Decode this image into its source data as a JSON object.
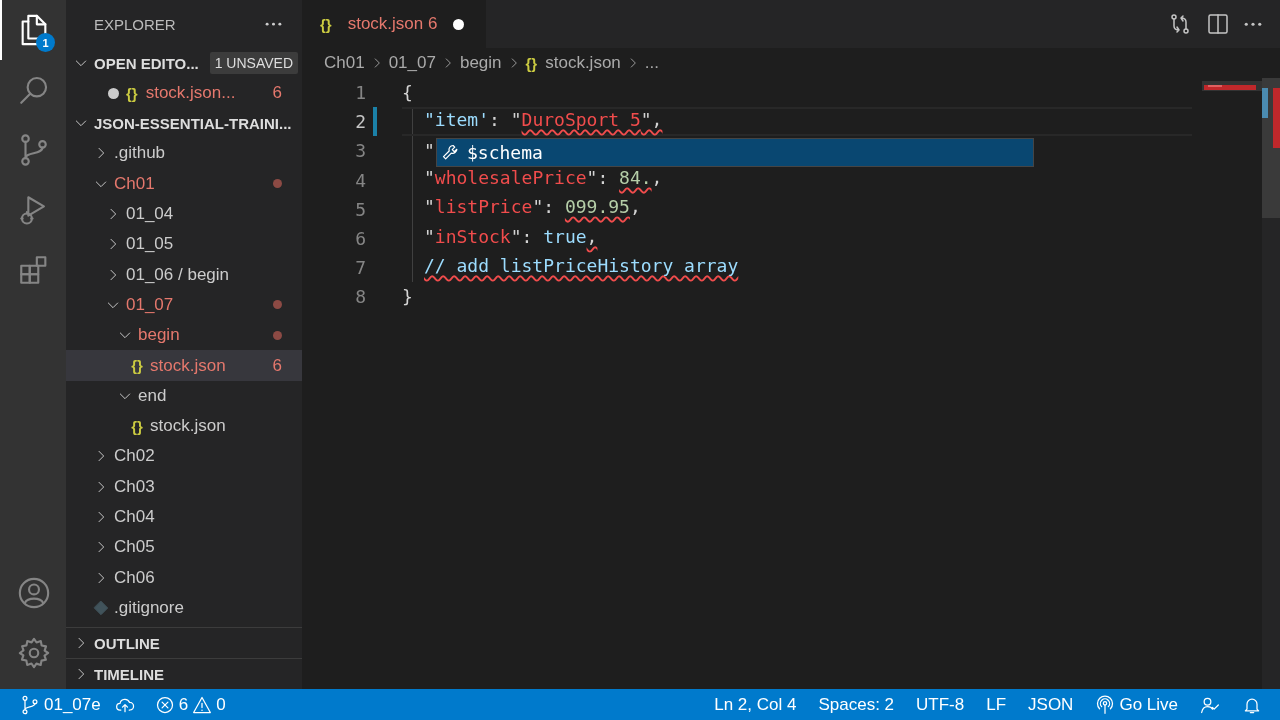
{
  "activity_bar": {
    "items": [
      {
        "kind": "files",
        "selected": true,
        "badge": "1"
      },
      {
        "kind": "search",
        "selected": false
      },
      {
        "kind": "scm",
        "selected": false
      },
      {
        "kind": "debug",
        "selected": false
      },
      {
        "kind": "extensions",
        "selected": false
      }
    ],
    "bottom": [
      {
        "kind": "account"
      },
      {
        "kind": "settings"
      }
    ]
  },
  "explorer": {
    "title": "EXPLORER",
    "open_editors": {
      "title": "OPEN EDITO...",
      "expanded": true,
      "badge": "1 UNSAVED",
      "items": [
        {
          "dirty": true,
          "icon": "{}",
          "label": "stock.json...",
          "problems": "6",
          "selected": false
        }
      ]
    },
    "project": {
      "title": "JSON-ESSENTIAL-TRAINI...",
      "expanded": true,
      "items": [
        {
          "kind": "folder",
          "label": ".github",
          "expanded": false,
          "modified": false,
          "selected": false
        },
        {
          "kind": "folder",
          "label": "Ch01",
          "expanded": true,
          "modified": true,
          "selected": false,
          "children": [
            {
              "kind": "folder",
              "label": "01_04",
              "expanded": false,
              "modified": false,
              "selected": false
            },
            {
              "kind": "folder",
              "label": "01_05",
              "expanded": false,
              "modified": false,
              "selected": false
            },
            {
              "kind": "folder",
              "label": "01_06 / begin",
              "expanded": false,
              "modified": false,
              "selected": false
            },
            {
              "kind": "folder",
              "label": "01_07",
              "expanded": true,
              "modified": true,
              "selected": false,
              "children": [
                {
                  "kind": "folder",
                  "label": "begin",
                  "expanded": true,
                  "modified": true,
                  "selected": false,
                  "children": [
                    {
                      "kind": "json-file",
                      "icon": "{}",
                      "label": "stock.json",
                      "modified": true,
                      "problems": "6",
                      "selected": true
                    }
                  ]
                },
                {
                  "kind": "folder",
                  "label": "end",
                  "expanded": true,
                  "modified": false,
                  "selected": false,
                  "children": [
                    {
                      "kind": "json-file",
                      "icon": "{}",
                      "label": "stock.json",
                      "modified": false,
                      "selected": false
                    }
                  ]
                }
              ]
            }
          ]
        },
        {
          "kind": "folder",
          "label": "Ch02",
          "expanded": false,
          "modified": false,
          "selected": false
        },
        {
          "kind": "folder",
          "label": "Ch03",
          "expanded": false,
          "modified": false,
          "selected": false
        },
        {
          "kind": "folder",
          "label": "Ch04",
          "expanded": false,
          "modified": false,
          "selected": false
        },
        {
          "kind": "folder",
          "label": "Ch05",
          "expanded": false,
          "modified": false,
          "selected": false
        },
        {
          "kind": "folder",
          "label": "Ch06",
          "expanded": false,
          "modified": false,
          "selected": false
        },
        {
          "kind": "git-file",
          "label": ".gitignore",
          "modified": false,
          "selected": false
        }
      ]
    },
    "sections": [
      {
        "title": "OUTLINE",
        "expanded": false
      },
      {
        "title": "TIMELINE",
        "expanded": false
      }
    ]
  },
  "tabs": [
    {
      "icon": "{}",
      "label": "stock.json",
      "problems": "6",
      "dirty": true,
      "selected": true
    }
  ],
  "editor_actions": [
    {
      "kind": "compare"
    },
    {
      "kind": "split"
    },
    {
      "kind": "more"
    }
  ],
  "breadcrumb": [
    {
      "label": "Ch01"
    },
    {
      "label": "01_07"
    },
    {
      "label": "begin"
    },
    {
      "icon": "{}",
      "label": "stock.json"
    },
    {
      "label": "..."
    }
  ],
  "code": {
    "lines": [
      {
        "number": "1",
        "current": false,
        "tokens": [
          {
            "text": "{",
            "kind": "punct"
          }
        ]
      },
      {
        "number": "2",
        "current": true,
        "tokens": [
          {
            "text": "\"item'",
            "kind": "key"
          },
          {
            "text": ": ",
            "kind": "punct"
          },
          {
            "text": "\"",
            "kind": "punct"
          },
          {
            "text": "DuroSport 5",
            "kind": "string",
            "squiggle": true
          },
          {
            "text": "\",",
            "kind": "punct",
            "squiggle": true
          }
        ]
      },
      {
        "number": "3",
        "current": false,
        "tokens": [
          {
            "text": "\"",
            "kind": "punct"
          }
        ]
      },
      {
        "number": "4",
        "current": false,
        "tokens": [
          {
            "text": "\"",
            "kind": "punct"
          },
          {
            "text": "wholesalePrice",
            "kind": "invalid-key"
          },
          {
            "text": "\": ",
            "kind": "punct"
          },
          {
            "text": "84.",
            "kind": "number",
            "squiggle": true
          },
          {
            "text": ",",
            "kind": "punct"
          }
        ]
      },
      {
        "number": "5",
        "current": false,
        "tokens": [
          {
            "text": "\"",
            "kind": "punct"
          },
          {
            "text": "listPrice",
            "kind": "invalid-key"
          },
          {
            "text": "\": ",
            "kind": "punct"
          },
          {
            "text": "099.95",
            "kind": "number",
            "squiggle": true
          },
          {
            "text": ",",
            "kind": "punct"
          }
        ]
      },
      {
        "number": "6",
        "current": false,
        "tokens": [
          {
            "text": "\"",
            "kind": "punct"
          },
          {
            "text": "inStock",
            "kind": "invalid-key"
          },
          {
            "text": "\": ",
            "kind": "punct"
          },
          {
            "text": "true",
            "kind": "literal"
          },
          {
            "text": ",",
            "kind": "punct",
            "squiggle": true
          }
        ]
      },
      {
        "number": "7",
        "current": false,
        "tokens": [
          {
            "text": "// add listPriceHistory array",
            "kind": "comment",
            "squiggle": true
          }
        ]
      },
      {
        "number": "8",
        "current": false,
        "tokens": [
          {
            "text": "}",
            "kind": "punct"
          }
        ]
      }
    ],
    "suggestions": {
      "items": [
        {
          "label": "$schema",
          "selected": true
        }
      ]
    }
  },
  "status_bar": {
    "left": [
      {
        "kind": "branch",
        "text": "01_07e"
      },
      {
        "kind": "sync"
      },
      {
        "kind": "errors",
        "text": "6"
      },
      {
        "kind": "warnings",
        "text": "0"
      }
    ],
    "right": [
      {
        "kind": "text",
        "text": "Ln 2, Col 4"
      },
      {
        "kind": "text",
        "text": "Spaces: 2"
      },
      {
        "kind": "text",
        "text": "UTF-8"
      },
      {
        "kind": "text",
        "text": "LF"
      },
      {
        "kind": "text",
        "text": "JSON"
      },
      {
        "kind": "golive",
        "text": "Go Live"
      },
      {
        "kind": "feedback"
      },
      {
        "kind": "bell"
      }
    ]
  }
}
